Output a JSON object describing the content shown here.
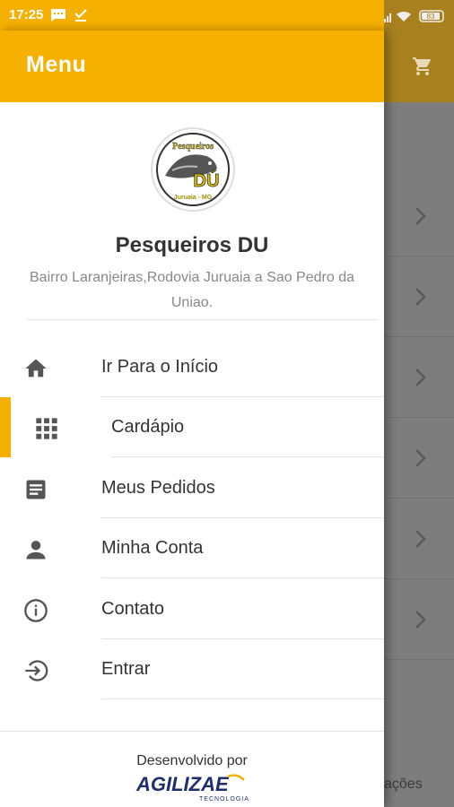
{
  "status_bar": {
    "time": "17:25",
    "battery": "83"
  },
  "drawer": {
    "title": "Menu"
  },
  "store": {
    "logo_text_top": "Pesqueiros",
    "logo_text_center": "DÚ",
    "logo_text_bottom": "Juruaia - MG",
    "name": "Pesqueiros DU",
    "address": "Bairro Laranjeiras,Rodovia Juruaia a Sao Pedro da Uniao."
  },
  "menu": {
    "items": [
      {
        "label": "Ir Para o Início",
        "icon": "home-icon"
      },
      {
        "label": "Cardápio",
        "icon": "grid-icon",
        "active": true
      },
      {
        "label": "Meus Pedidos",
        "icon": "receipt-icon"
      },
      {
        "label": "Minha Conta",
        "icon": "person-icon"
      },
      {
        "label": "Contato",
        "icon": "info-icon"
      },
      {
        "label": "Entrar",
        "icon": "login-icon"
      }
    ]
  },
  "footer": {
    "developed_by": "Desenvolvido por",
    "brand_name": "AGILIZAE",
    "brand_sub": "TECNOLOGIA"
  },
  "background": {
    "bottom_text": "ações"
  },
  "colors": {
    "accent": "#f5b000",
    "text": "#333333",
    "muted": "#888888"
  }
}
